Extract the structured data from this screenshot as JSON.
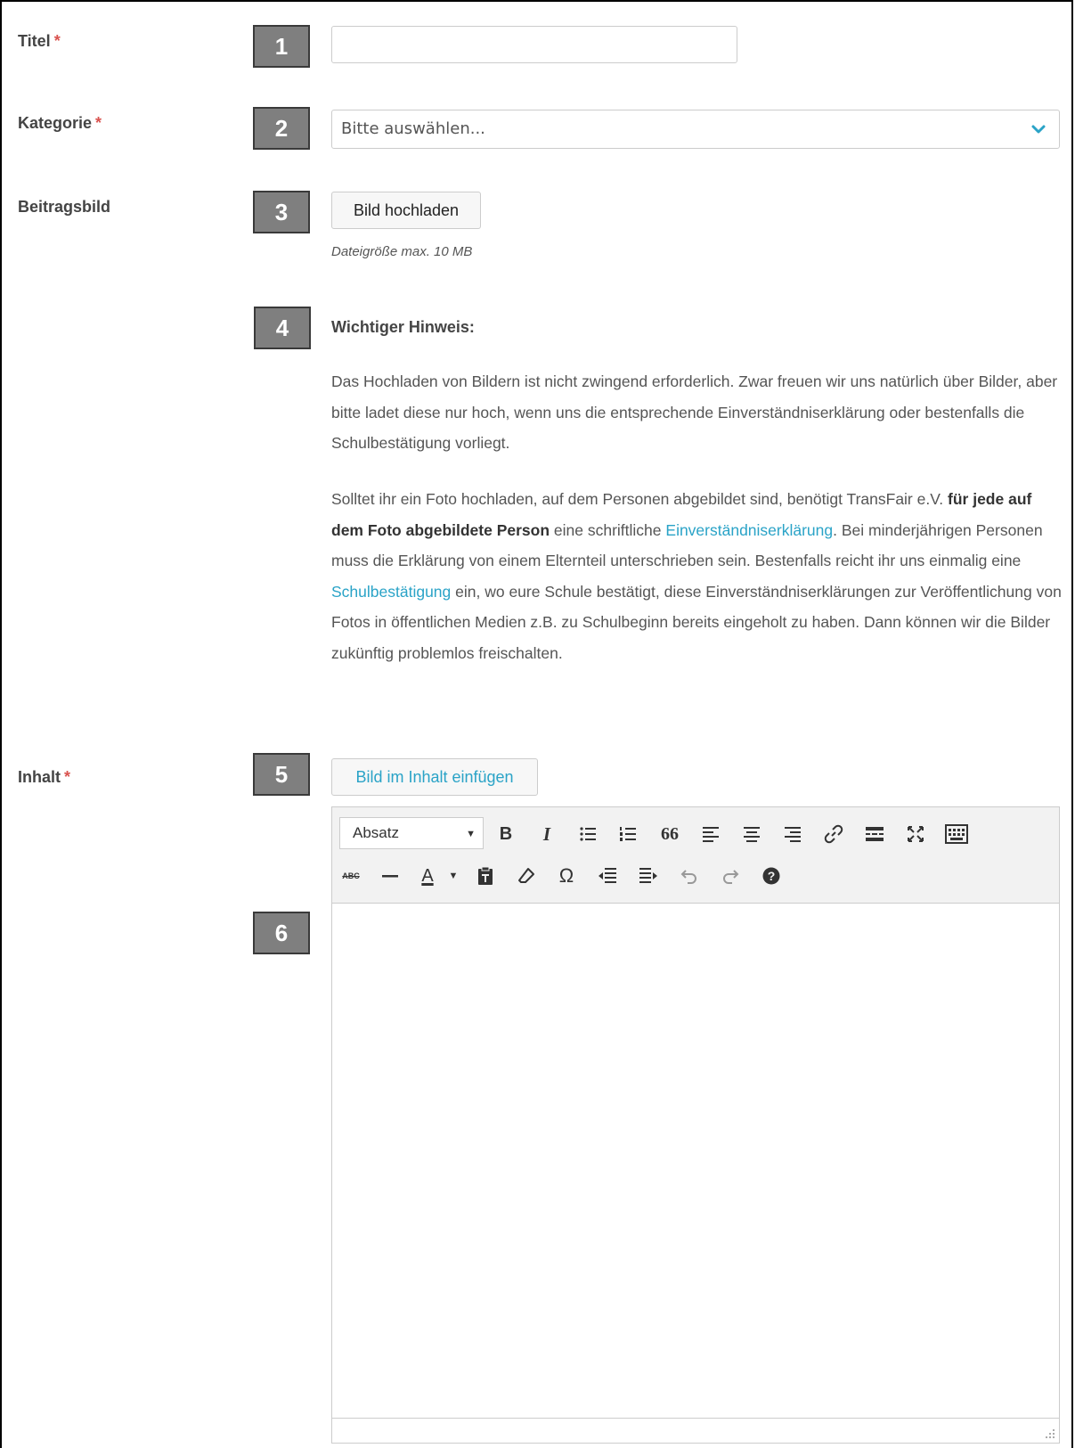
{
  "form": {
    "title_label": "Titel",
    "category_label": "Kategorie",
    "image_label": "Beitragsbild",
    "content_label": "Inhalt",
    "required_mark": "*",
    "category_placeholder": "Bitte auswählen...",
    "upload_button": "Bild hochladen",
    "file_size_hint": "Dateigröße max. 10 MB",
    "insert_image_button": "Bild im Inhalt einfügen"
  },
  "badges": [
    "1",
    "2",
    "3",
    "4",
    "5",
    "6"
  ],
  "notice": {
    "title": "Wichtiger Hinweis:",
    "p1": "Das Hochladen von Bildern ist nicht zwingend erforderlich. Zwar freuen wir uns natürlich über Bilder, aber bitte ladet diese nur hoch, wenn uns die entsprechende Einverständniserklärung oder bestenfalls die Schulbestätigung vorliegt.",
    "p2_a": "Solltet ihr ein Foto hochladen, auf dem Personen abgebildet sind, benötigt TransFair e.V. ",
    "p2_bold": "für jede auf dem Foto abgebildete Person",
    "p2_b": " eine schriftliche ",
    "p2_link1": "Einverständniserklärung",
    "p2_c": ". Bei minderjährigen Personen muss die Erklärung von einem Elternteil unterschrieben sein. Bestenfalls reicht ihr uns einmalig eine ",
    "p2_link2": "Schulbestätigung",
    "p2_d": " ein, wo eure Schule bestätigt, diese Einverständniserklärungen zur Veröffentlichung von Fotos in öffentlichen Medien z.B. zu Schulbeginn bereits eingeholt zu haben. Dann können wir die Bilder zukünftig problemlos freischalten."
  },
  "editor": {
    "format_select": "Absatz",
    "toolbar_row1": [
      "bold-icon",
      "italic-icon",
      "bullet-list-icon",
      "numbered-list-icon",
      "blockquote-icon",
      "align-left-icon",
      "align-center-icon",
      "align-right-icon",
      "link-icon",
      "read-more-icon",
      "fullscreen-icon",
      "toolbar-toggle-icon"
    ],
    "toolbar_row2": [
      "strikethrough-icon",
      "horizontal-line-icon",
      "text-color-icon",
      "paste-text-icon",
      "clear-format-icon",
      "special-char-icon",
      "outdent-icon",
      "indent-icon",
      "undo-icon",
      "redo-icon",
      "help-icon"
    ],
    "bold_glyph": "B",
    "italic_glyph": "I",
    "quote_glyph": "66",
    "text_color_glyph": "A",
    "strike_glyph": "ABC",
    "omega_glyph": "Ω"
  },
  "colors": {
    "link": "#2aa3c7",
    "required": "#d9534f",
    "badge_bg": "#7f7f7f"
  }
}
